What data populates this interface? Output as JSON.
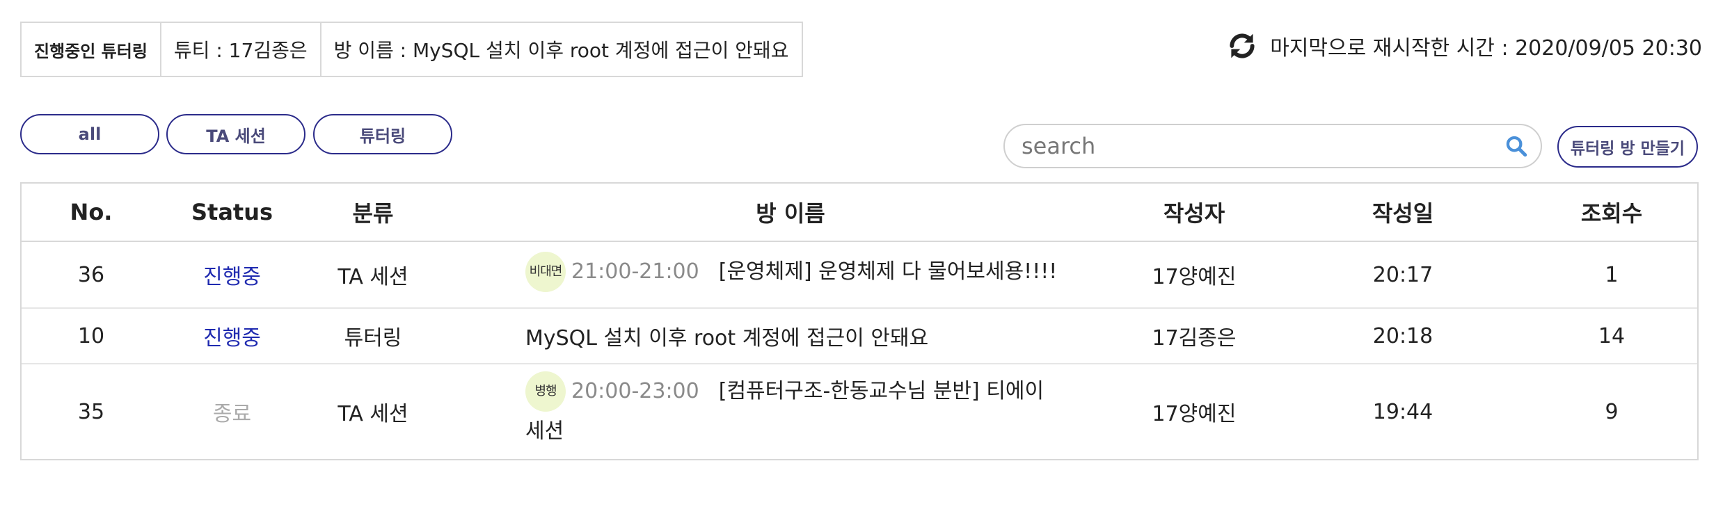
{
  "info_bar": {
    "label": "진행중인 튜터링",
    "tutee": "튜티 : 17김종은",
    "room": "방 이름 : MySQL 설치 이후 root 계정에 접근이 안돼요"
  },
  "restart": {
    "text": "마지막으로 재시작한 시간 : 2020/09/05 20:30",
    "icon": "refresh-icon"
  },
  "filters": [
    "all",
    "TA 세션",
    "튜터링"
  ],
  "search": {
    "placeholder": "search",
    "value": "",
    "icon": "search-icon"
  },
  "create_button": "튜터링 방 만들기",
  "colors": {
    "accent": "#2b2b8a",
    "status_live": "#1f2ab0",
    "status_done": "#aaaaaa",
    "badge_bg": "#eef6cf",
    "search_icon": "#4a90d9"
  },
  "table": {
    "columns": [
      "No.",
      "Status",
      "분류",
      "방 이름",
      "작성자",
      "작성일",
      "조회수"
    ],
    "rows": [
      {
        "no": "36",
        "status": "진행중",
        "category": "TA 세션",
        "badge": "비대면",
        "time": "21:00-21:00",
        "title": "[운영체제] 운영체제 다 물어보세용!!!!",
        "author": "17양예진",
        "date": "20:17",
        "views": "1"
      },
      {
        "no": "10",
        "status": "진행중",
        "category": "튜터링",
        "badge": "",
        "time": "",
        "title": "MySQL 설치 이후 root 계정에 접근이 안돼요",
        "author": "17김종은",
        "date": "20:18",
        "views": "14"
      },
      {
        "no": "35",
        "status": "종료",
        "category": "TA 세션",
        "badge": "병행",
        "time": "20:00-23:00",
        "title": "[컴퓨터구조-한동교수님 분반] 티에이 세션",
        "author": "17양예진",
        "date": "19:44",
        "views": "9"
      }
    ]
  }
}
